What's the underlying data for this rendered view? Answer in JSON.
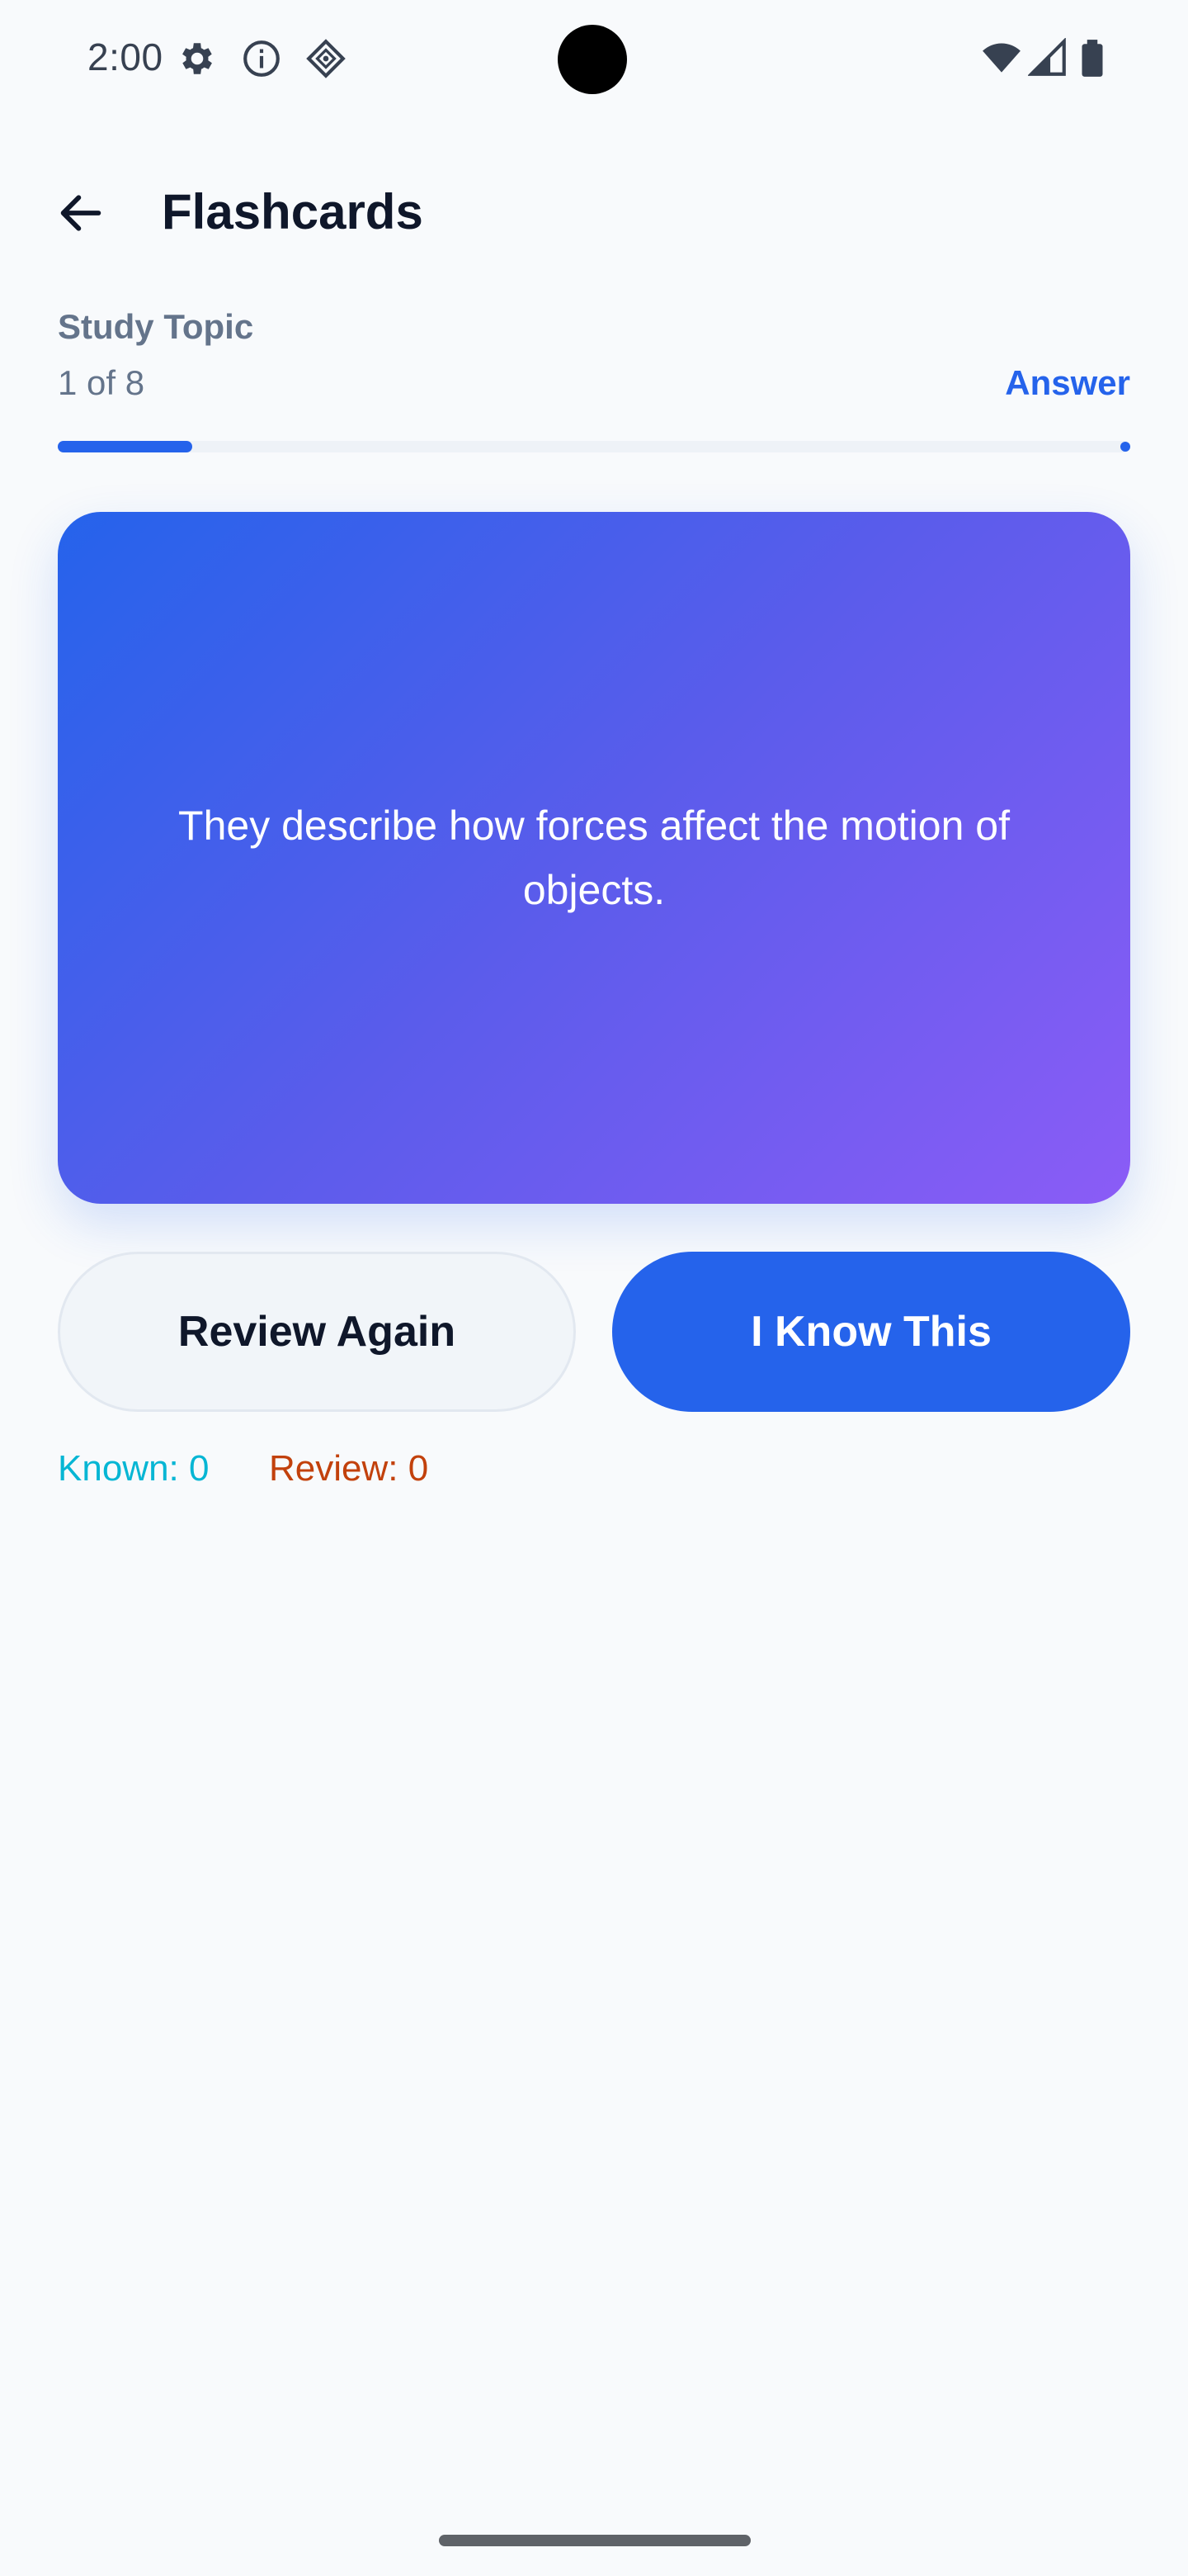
{
  "status_bar": {
    "time": "2:00",
    "icons": [
      "gear-icon",
      "info-icon",
      "diamond-icon",
      "wifi-icon",
      "cell-signal-icon",
      "battery-icon"
    ]
  },
  "header": {
    "title": "Flashcards",
    "back_icon": "arrow-left-icon"
  },
  "progress": {
    "topic_label": "Study Topic",
    "count_text": "1 of 8",
    "side_label": "Answer",
    "fraction": 0.125
  },
  "card": {
    "text": "They describe how forces affect the motion of objects."
  },
  "actions": {
    "review_again": "Review Again",
    "know_this": "I Know This"
  },
  "stats": {
    "known": "Known: 0",
    "review": "Review: 0"
  },
  "colors": {
    "accent": "#2563EB",
    "card_gradient_start": "#2563EB",
    "card_gradient_end": "#8B5CF6",
    "known": "#06B6D4",
    "review": "#C2410C",
    "background": "#F8FAFC"
  }
}
